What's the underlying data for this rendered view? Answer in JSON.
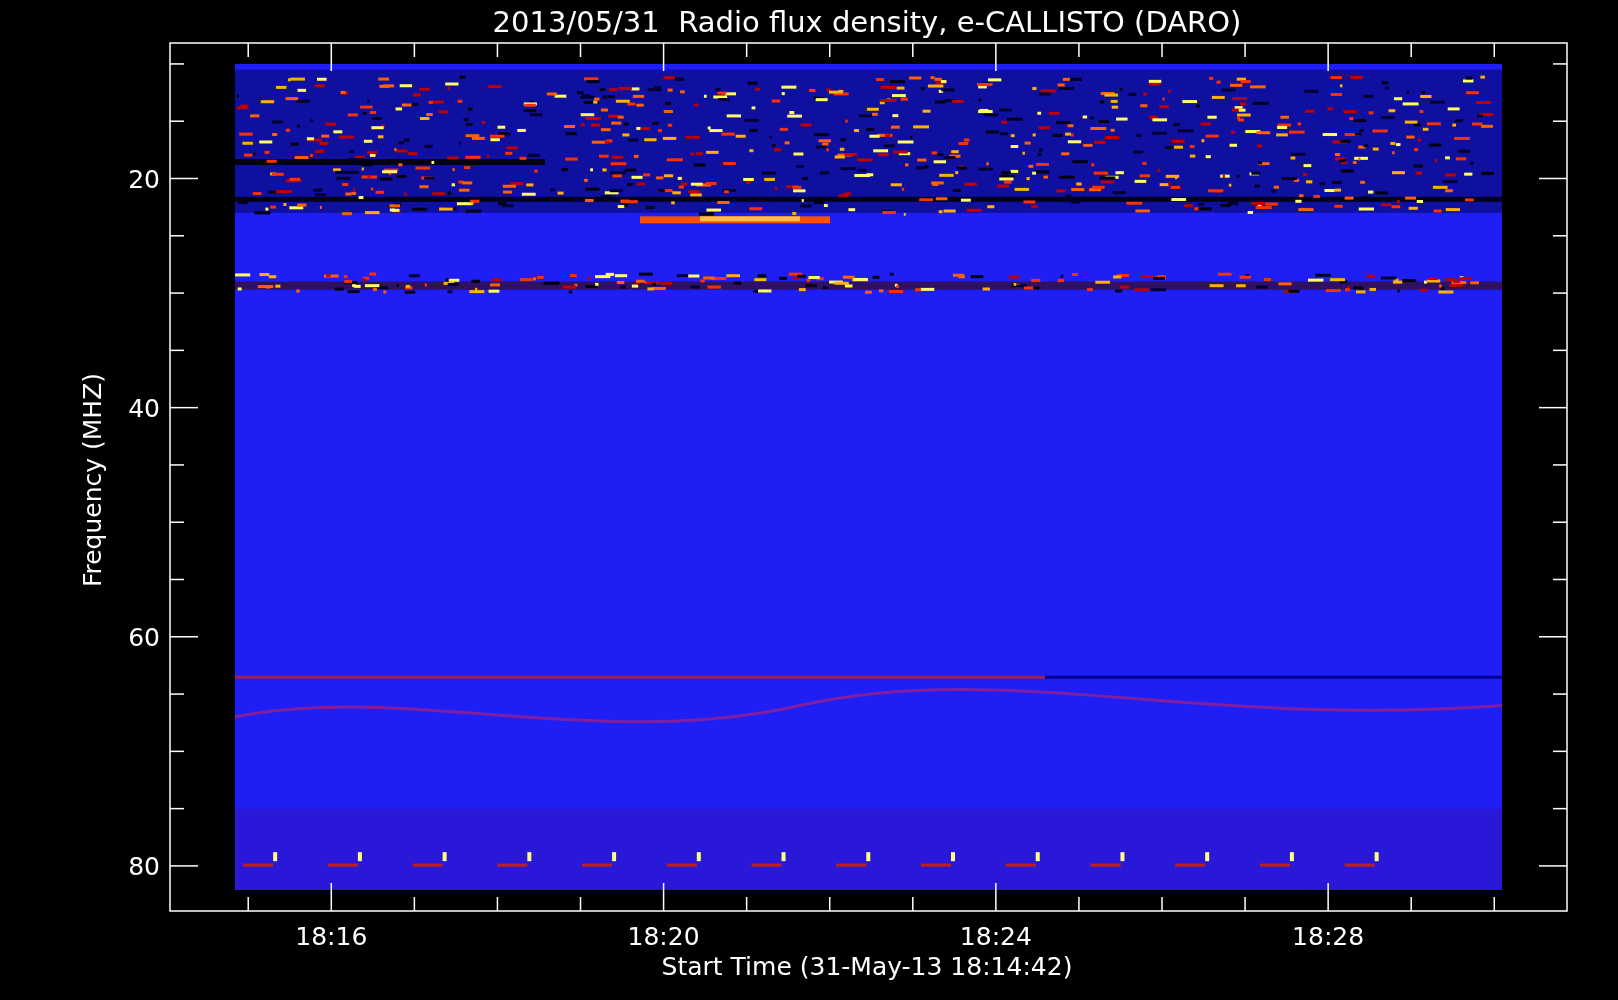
{
  "title": "2013/05/31  Radio flux density, e-CALLISTO (DARO)",
  "y_axis": {
    "label": "Frequency (MHZ)",
    "ticks": [
      "20",
      "40",
      "60",
      "80"
    ]
  },
  "x_axis": {
    "label": "Start Time (31-May-13 18:14:42)",
    "ticks": [
      "18:16",
      "18:20",
      "18:24",
      "18:28"
    ]
  }
}
